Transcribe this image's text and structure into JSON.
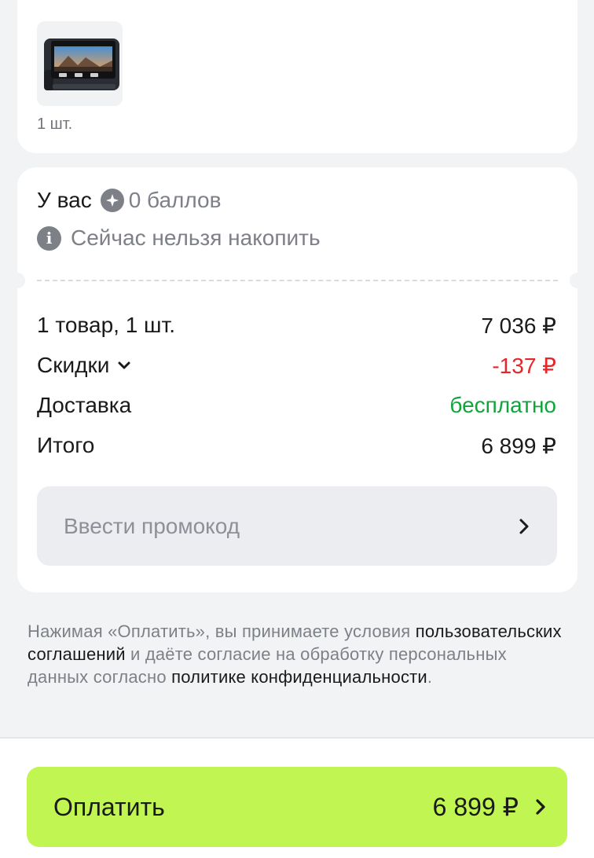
{
  "product": {
    "quantity": "1 шт.",
    "image_icon": "dashcam-product-image"
  },
  "points": {
    "label": "У вас",
    "value": "0 баллов",
    "info": "Сейчас нельзя накопить"
  },
  "summary": {
    "items_label": "1 товар, 1 шт.",
    "items_value": "7 036 ₽",
    "discount_label": "Скидки",
    "discount_value": "-137 ₽",
    "delivery_label": "Доставка",
    "delivery_value": "бесплатно",
    "total_label": "Итого",
    "total_value": "6 899 ₽"
  },
  "promo": {
    "placeholder": "Ввести промокод"
  },
  "legal": {
    "text_1": "Нажимая «Оплатить», вы принимаете условия ",
    "link_1": "пользовательских соглашений",
    "text_2": " и даёте согласие на обработку персональных данных согласно ",
    "link_2": "политике конфиденциальности",
    "text_3": "."
  },
  "pay": {
    "label": "Оплатить",
    "amount": "6 899 ₽"
  },
  "colors": {
    "accent_green_button": "#c1f551",
    "discount_red": "#e5262a",
    "free_green": "#10a53a",
    "muted_gray": "#7d8087"
  }
}
